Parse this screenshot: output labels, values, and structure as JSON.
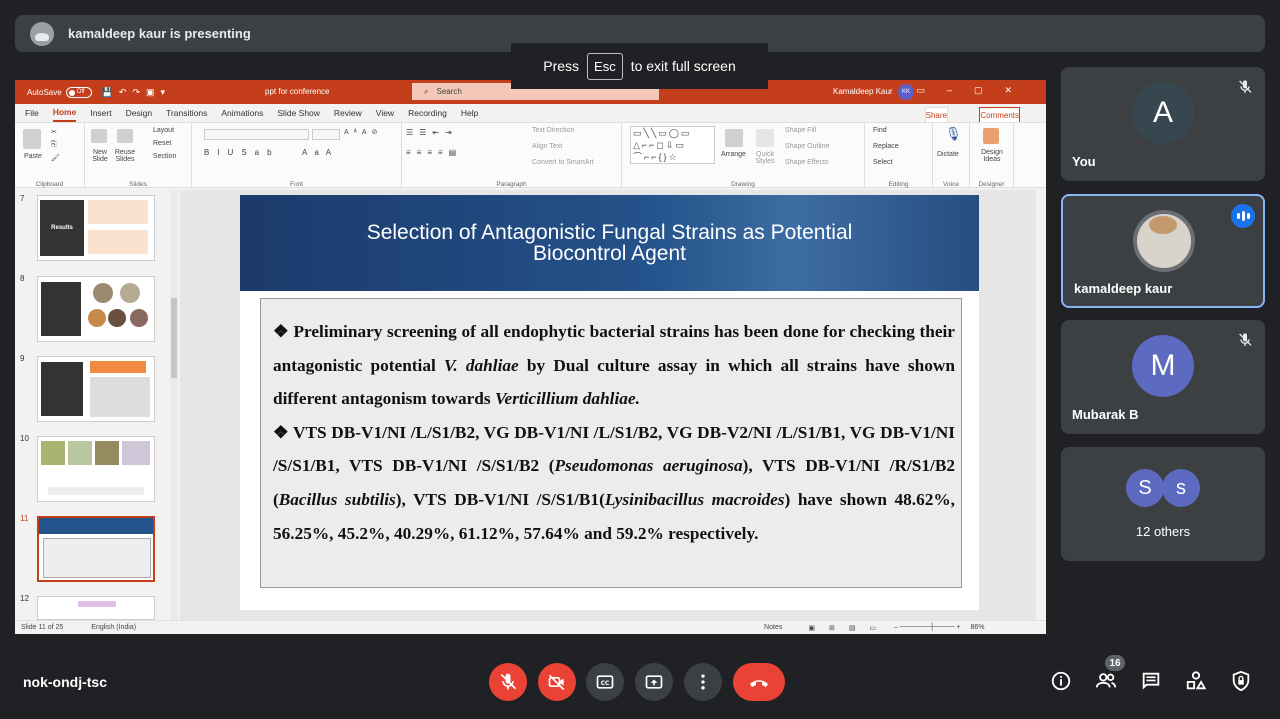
{
  "meet": {
    "presenter_banner": "kamaldeep kaur is presenting",
    "esc_hint": {
      "before": "Press",
      "key": "Esc",
      "after": "to exit full screen"
    },
    "meeting_code": "nok-ondj-tsc",
    "people_count": "16"
  },
  "participants": [
    {
      "name": "You",
      "initial": "A",
      "color": "#37474f",
      "muted": true
    },
    {
      "name": "kamaldeep kaur",
      "speaking": true,
      "highlight": "#8ab4f8"
    },
    {
      "name": "Mubarak B",
      "initial": "M",
      "color": "#5c6bc0",
      "muted": true
    },
    {
      "name": "12 others",
      "initials": [
        "S",
        "s"
      ]
    }
  ],
  "ppt": {
    "autosave_label": "AutoSave",
    "autosave_state": "Off",
    "filename": "ppt for conference",
    "search_placeholder": "Search",
    "user": "Kamaldeep Kaur",
    "user_initials": "KK",
    "tabs": [
      "File",
      "Home",
      "Insert",
      "Design",
      "Transitions",
      "Animations",
      "Slide Show",
      "Review",
      "View",
      "Recording",
      "Help"
    ],
    "active_tab": "Home",
    "share": "Share",
    "comments": "Comments",
    "groups": {
      "clipboard": "Clipboard",
      "slides": "Slides",
      "font": "Font",
      "paragraph": "Paragraph",
      "drawing": "Drawing",
      "editing": "Editing",
      "voice": "Voice",
      "designer": "Designer"
    },
    "buttons": {
      "paste": "Paste",
      "new_slide": "New Slide",
      "reuse_slides": "Reuse Slides",
      "layout": "Layout",
      "reset": "Reset",
      "section": "Section",
      "text_direction": "Text Direction",
      "align_text": "Align Text",
      "convert_smartart": "Convert to SmartArt",
      "arrange": "Arrange",
      "quick_styles": "Quick Styles",
      "shape_fill": "Shape Fill",
      "shape_outline": "Shape Outline",
      "shape_effects": "Shape Effects",
      "find": "Find",
      "replace": "Replace",
      "select": "Select",
      "dictate": "Dictate",
      "design_ideas": "Design Ideas"
    },
    "thumb_numbers": [
      "7",
      "8",
      "9",
      "10",
      "11",
      "12"
    ],
    "thumb_results_text": "Results",
    "selected_slide": "11",
    "status": {
      "slide_info": "Slide 11 of 25",
      "language": "English (India)",
      "notes": "Notes",
      "zoom": "86%"
    }
  },
  "slide": {
    "title_line1": "Selection of Antagonistic Fungal Strains as Potential",
    "title_line2": "Biocontrol Agent",
    "bullet1": {
      "t1": "Preliminary screening of all endophytic bacterial strains has been done for checking their antagonistic potential ",
      "i1": "V. dahliae",
      "t2": " by Dual culture assay in which all strains have shown different antagonism towards ",
      "i2": "Verticillium dahliae."
    },
    "bullet2": {
      "t1": "VTS DB-V1/NI /L/S1/B2, VG DB-V1/NI /L/S1/B2, VG DB-V2/NI /L/S1/B1, VG DB-V1/NI /S/S1/B1, VTS DB-V1/NI /S/S1/B2 (",
      "i1": "Pseudomonas aeruginosa",
      "t2": "), VTS DB-V1/NI /R/S1/B2 (",
      "i2": "Bacillus subtilis",
      "t3": "), VTS DB-V1/NI /S/S1/B1(",
      "i3": "Lysinibacillus macroides",
      "t4": ") have shown 48.62%, 56.25%, 45.2%, 40.29%, 61.12%, 57.64% and 59.2% respectively."
    }
  },
  "colors": {
    "meet_bg": "#202124",
    "tile_bg": "#3c4043",
    "ppt_accent": "#c43e1c",
    "end_call": "#ea4335"
  }
}
